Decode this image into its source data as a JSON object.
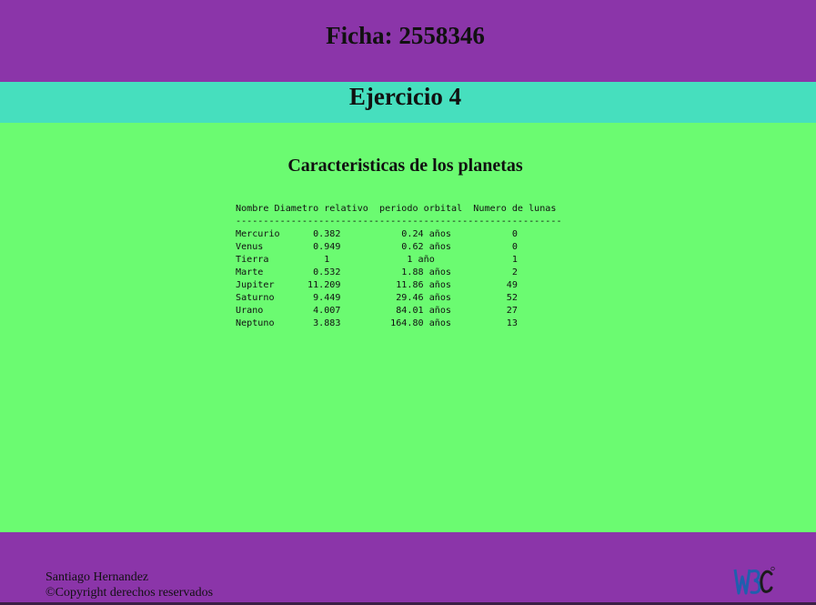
{
  "header": {
    "title": "Ficha: 2558346"
  },
  "subheader": {
    "title": "Ejercicio 4"
  },
  "main": {
    "heading": "Caracteristicas de los planetas",
    "table": {
      "header_row": "Nombre Diametro relativo  periodo orbital  Numero de lunas",
      "separator": "-----------------------------------------------------------",
      "rows": [
        "Mercurio      0.382           0.24 años           0",
        "Venus         0.949           0.62 años           0",
        "Tierra          1              1 año              1",
        "Marte         0.532           1.88 años           2",
        "Jupiter      11.209          11.86 años          49",
        "Saturno       9.449          29.46 años          52",
        "Urano         4.007          84.01 años          27",
        "Neptuno       3.883         164.80 años          13"
      ]
    }
  },
  "footer": {
    "author": "Santiago Hernandez",
    "copyright": "©Copyright derechos reservados",
    "badge_icon": "w3c-logo-icon"
  },
  "colors": {
    "header": "#8b35a9",
    "subheader": "#46dfbe",
    "main": "#6bfb71",
    "footer": "#8b35a9"
  }
}
